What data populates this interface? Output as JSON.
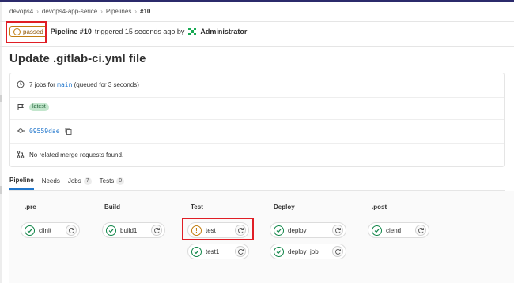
{
  "breadcrumb": [
    "devops4",
    "devops4-app-serice",
    "Pipelines",
    "#10"
  ],
  "status": {
    "badge": "passed",
    "pipeline_label": "Pipeline #10",
    "triggered_text": "triggered 15 seconds ago by",
    "user": "Administrator"
  },
  "title": "Update .gitlab-ci.yml file",
  "info": {
    "jobs_prefix": "7 jobs for",
    "branch": "main",
    "queued": "(queued for 3 seconds)",
    "tag": "latest",
    "commit": "09559dae",
    "merge_requests": "No related merge requests found."
  },
  "tabs": [
    {
      "label": "Pipeline",
      "count": ""
    },
    {
      "label": "Needs",
      "count": ""
    },
    {
      "label": "Jobs",
      "count": "7"
    },
    {
      "label": "Tests",
      "count": "0"
    }
  ],
  "stages": [
    {
      "name": ".pre",
      "jobs": [
        "ciinit"
      ]
    },
    {
      "name": "Build",
      "jobs": [
        "build1"
      ]
    },
    {
      "name": "Test",
      "jobs": [
        "test",
        "test1"
      ]
    },
    {
      "name": "Deploy",
      "jobs": [
        "deploy",
        "deploy_job"
      ]
    },
    {
      "name": ".post",
      "jobs": [
        "ciend"
      ]
    }
  ],
  "colors": {
    "success": "#108548",
    "warning": "#c17d10",
    "highlight": "#e01e25",
    "link": "#1f75cb"
  }
}
